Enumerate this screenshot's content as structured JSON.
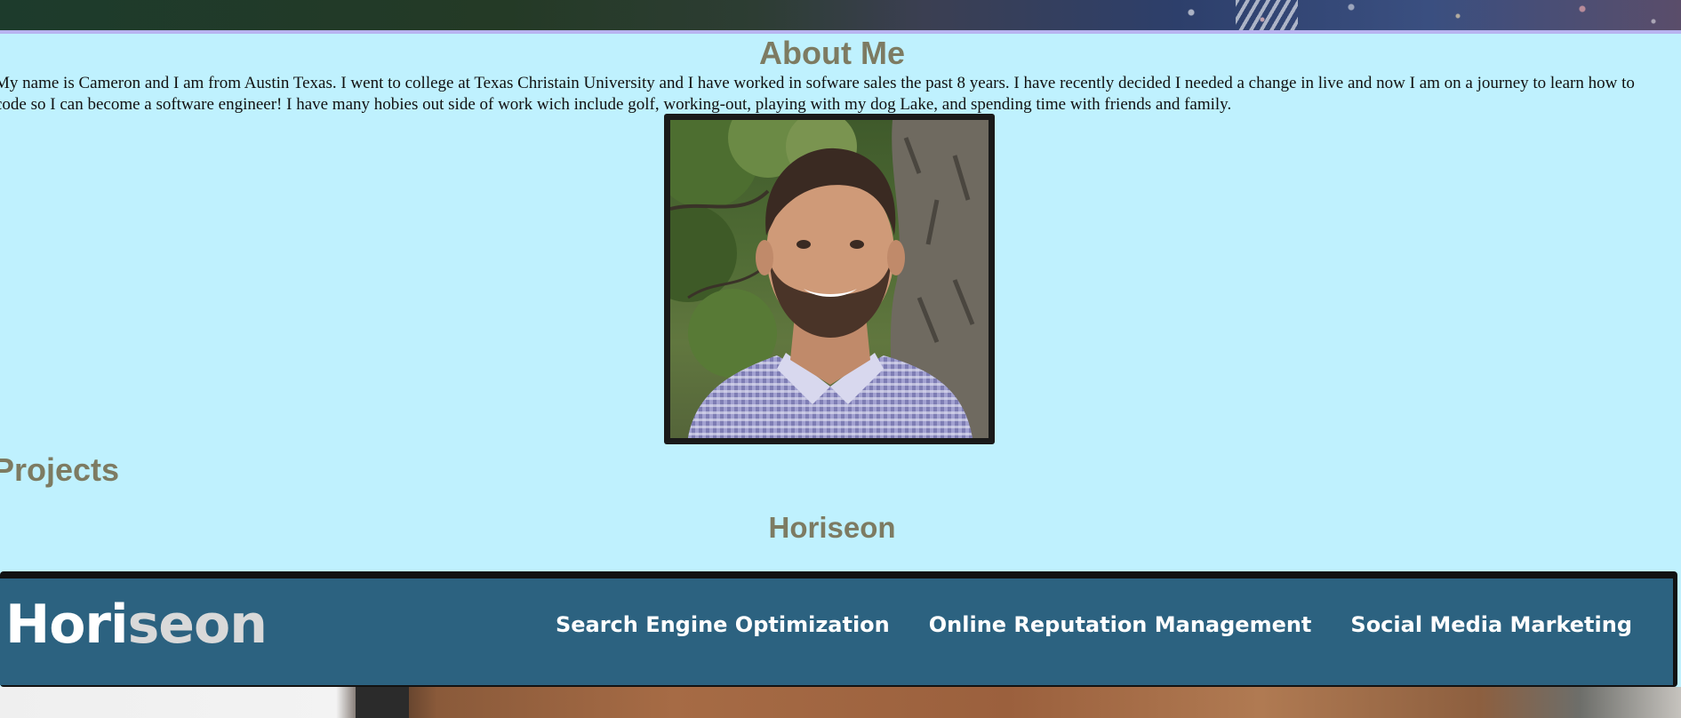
{
  "about": {
    "title": "About Me",
    "text": "My name is Cameron and I am from Austin Texas. I went to college at Texas Christain University and I have worked in sofware sales the past 8 years. I have recently decided I needed a change in live and now I am on a journey to learn how to code so I can become a software engineer! I have many hobies out side of work wich include golf, working-out, playing with my dog Lake, and spending time with friends and family."
  },
  "projects": {
    "title": "Projects",
    "items": [
      {
        "name": "Horiseon",
        "brand_part1": "Hori",
        "brand_part2": "seon",
        "nav": [
          "Search Engine Optimization",
          "Online Reputation Management",
          "Social Media Marketing"
        ]
      }
    ]
  },
  "colors": {
    "page_background": "#bff1fe",
    "heading": "#7d7b62",
    "project_nav": "#2c6280"
  }
}
